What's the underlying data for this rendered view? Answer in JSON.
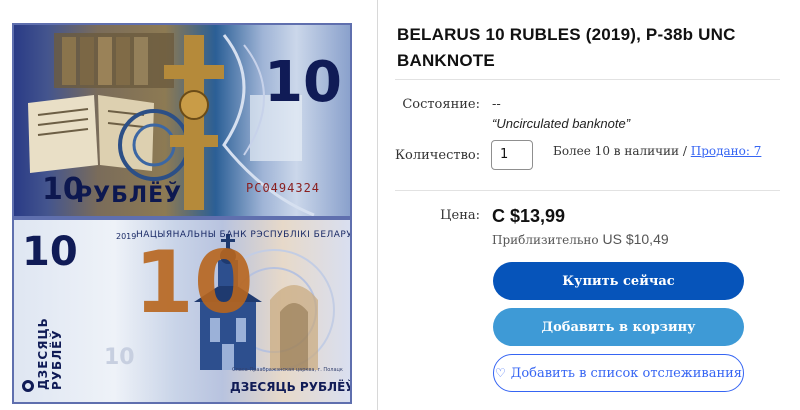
{
  "banknote": {
    "front": {
      "denomination": "10",
      "currency": "РУБЛЁЎ",
      "serial": "РС0494324"
    },
    "back": {
      "denomination": "10",
      "year": "2019",
      "bank_name": "НАЦЫЯНАЛЬНЫ БАНК РЭСПУБЛІКІ БЕЛАРУСЬ",
      "amount_words": "ДЗЕСЯЦЬ РУБЛЁЎ",
      "caption": "Спаса-Праабражэнская царква, г. Полацк"
    }
  },
  "listing": {
    "title": "BELARUS 10 RUBLES (2019), P-38b UNC BANKNOTE",
    "condition_label": "Состояние:",
    "condition_value": "--",
    "condition_note": "“Uncirculated banknote”",
    "quantity_label": "Количество:",
    "quantity_value": "1",
    "availability": "Более 10 в наличии",
    "separator": "/",
    "sold": "Продано: 7",
    "price_label": "Цена:",
    "price": "C $13,99",
    "approx_label": "Приблизительно",
    "approx_price": "US $10,49",
    "buy_now": "Купить сейчас",
    "add_to_cart": "Добавить в корзину",
    "watchlist": "Добавить в список отслеживания"
  },
  "colors": {
    "buy_now_bg": "#0654ba",
    "add_to_cart_bg": "#3e9ad6",
    "link": "#3665f3"
  }
}
